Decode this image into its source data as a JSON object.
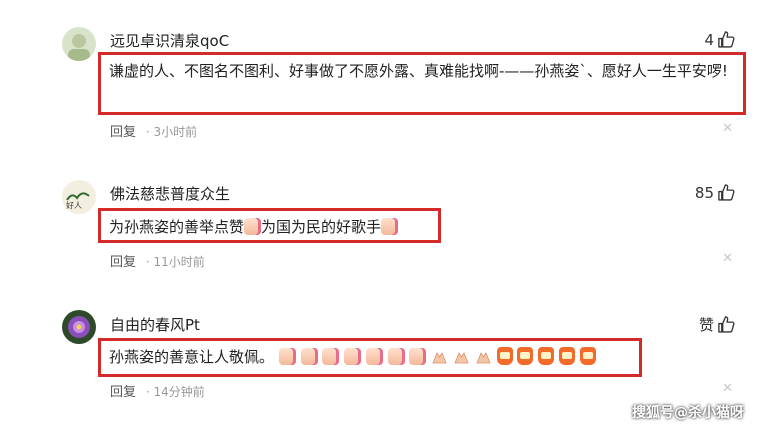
{
  "comments": [
    {
      "username": "远见卓识清泉qoC",
      "likes": "4",
      "text": "谦虚的人、不图名不图利、好事做了不愿外露、真难能找啊-——孙燕姿`、愿好人一生平安啰!",
      "reply_label": "回复",
      "time": "3小时前"
    },
    {
      "username": "佛法慈悲普度众生",
      "likes": "85",
      "text_a": "为孙燕姿的善举点赞",
      "text_b": "为国为民的好歌手",
      "reply_label": "回复",
      "time": "11小时前"
    },
    {
      "username": "自由的春风Pt",
      "likes": "赞",
      "text": "孙燕姿的善意让人敬佩。",
      "reply_label": "回复",
      "time": "14分钟前"
    }
  ],
  "icons": {
    "like": "thumbs-up-outline-icon",
    "close": "close-icon",
    "emoji_thumb": "thumbs-up-emoji",
    "emoji_pray": "pray-hands-emoji",
    "emoji_cheer": "jiayou-cheer-emoji"
  },
  "colors": {
    "highlight_border": "#d42a2a",
    "meta_gray": "#999999"
  },
  "watermark": "搜狐号@杀小猫呀"
}
